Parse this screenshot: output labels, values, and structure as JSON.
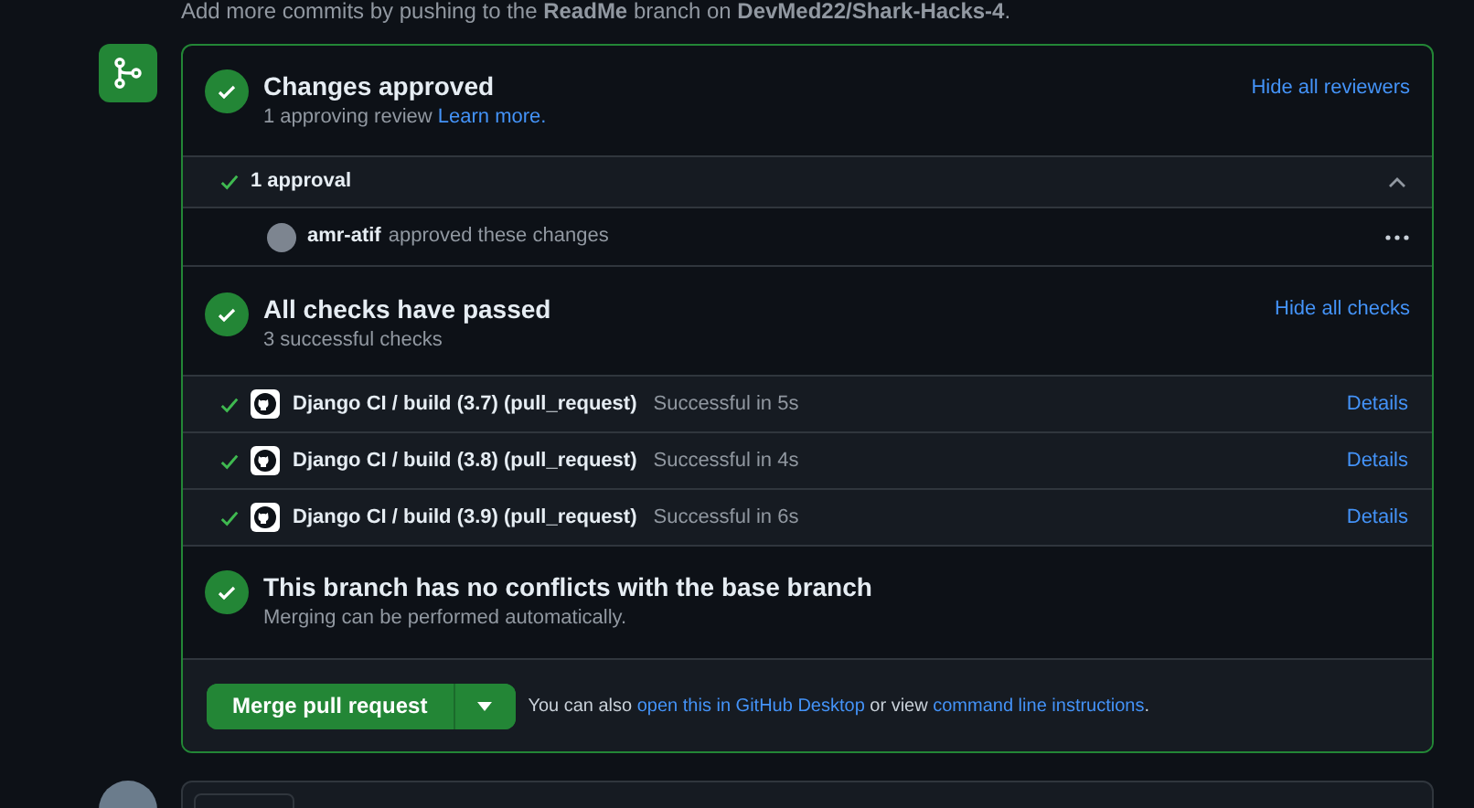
{
  "notice": {
    "text": "Add more commits by pushing to the **ReadMe** branch on **DevMed22/Shark-Hacks-4**."
  },
  "review": {
    "title": "Changes approved",
    "subtitle": "1 approving review",
    "link": "Learn more.",
    "action": "Hide all reviewers"
  },
  "approvals": {
    "label": "1 approval",
    "expanded": true,
    "reviewers": [
      {
        "user": "amr-atif",
        "text": "approved these changes"
      }
    ]
  },
  "checks": {
    "title": "All checks have passed",
    "subtitle": "3 successful checks",
    "action": "Hide all checks",
    "items": [
      {
        "name": "Django CI / build (3.7) (pull_request)",
        "status": "Successful in 5s",
        "link": "Details"
      },
      {
        "name": "Django CI / build (3.8) (pull_request)",
        "status": "Successful in 4s",
        "link": "Details"
      },
      {
        "name": "Django CI / build (3.9) (pull_request)",
        "status": "Successful in 6s",
        "link": "Details"
      }
    ]
  },
  "merge_status": {
    "title": "This branch has no conflicts with the base branch",
    "subtitle": "Merging can be performed automatically."
  },
  "merge": {
    "button": "Merge pull request",
    "before": "You can also",
    "link1": "open this in GitHub Desktop",
    "middle": "or view",
    "link2": "command line instructions",
    "end": "."
  }
}
